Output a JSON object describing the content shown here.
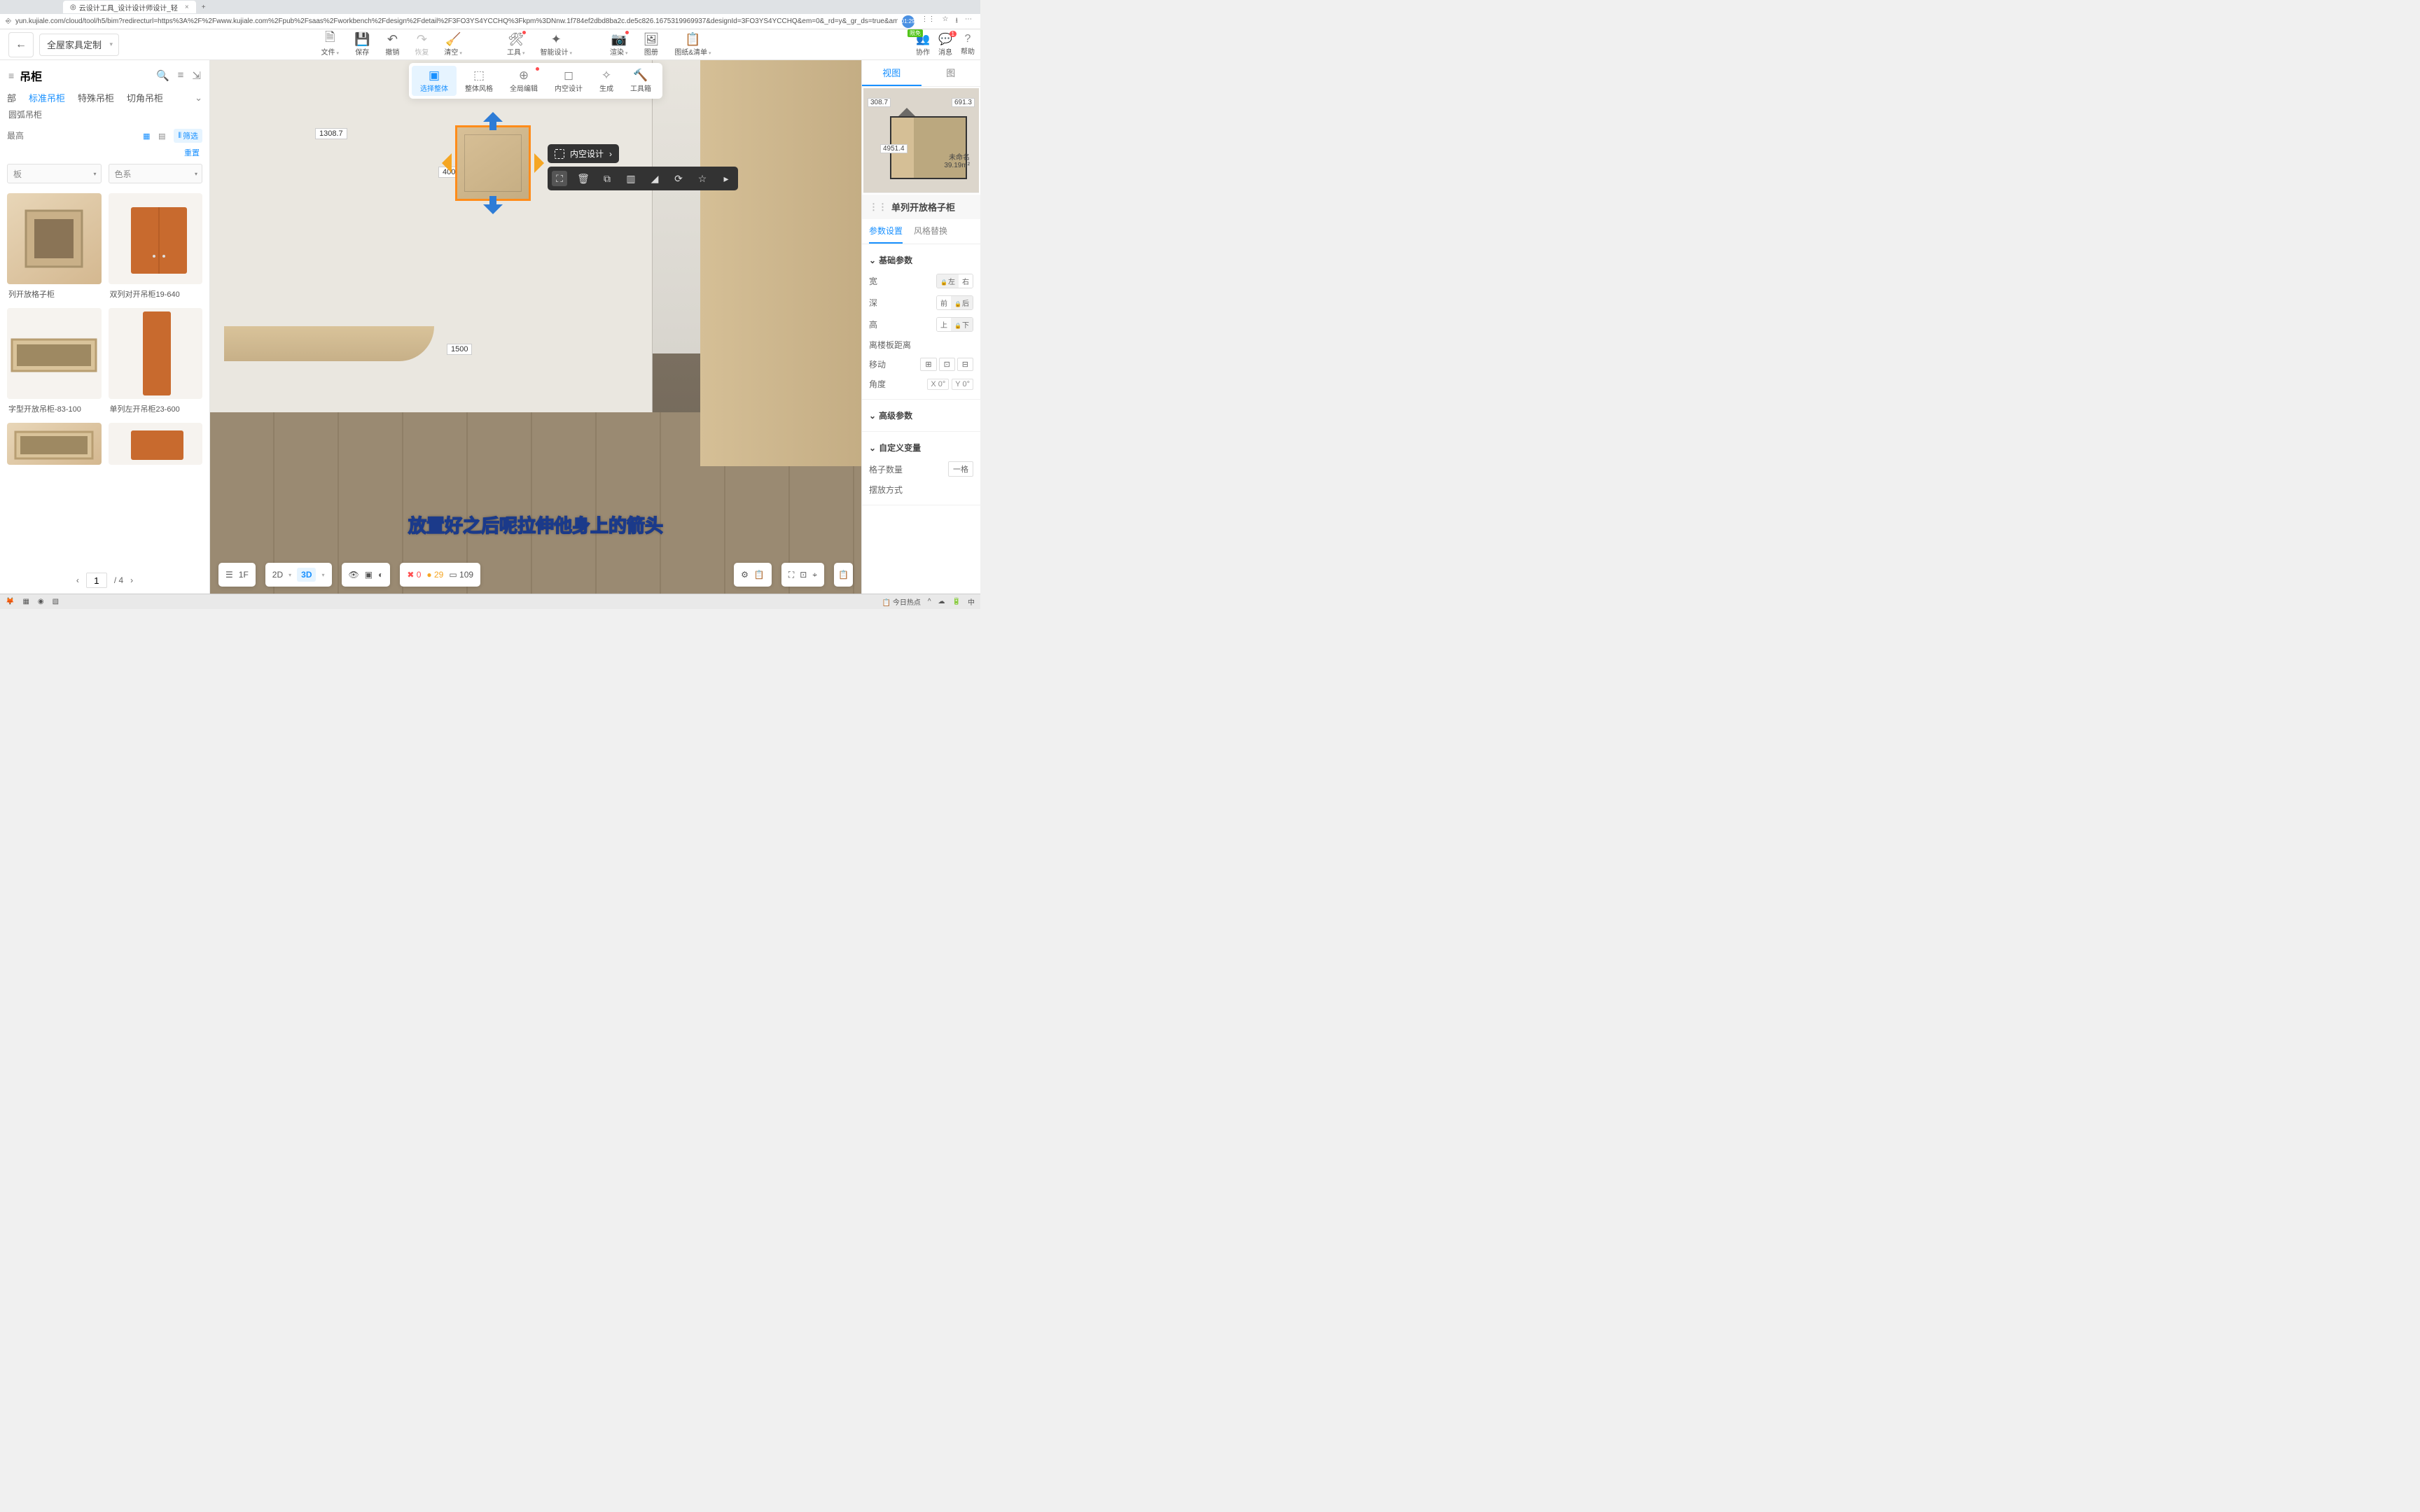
{
  "browser": {
    "tab_title": "云设计工具_设计设计师设计_轻",
    "url": "yun.kujiale.com/cloud/tool/h5/bim?redirecturl=https%3A%2F%2Fwww.kujiale.com%2Fpub%2Fsaas%2Fworkbench%2Fdesign%2Fdetail%2F3FO3YS4YCCHQ%3Fkpm%3DNnw.1f784ef2dbd8ba2c.de5c826.1675319969937&designId=3FO3YS4YCCHQ&em=0&_rd=y&_gr_ds=true&am=true",
    "avatar_time": "01:29"
  },
  "topbar": {
    "mode": "全屋家具定制",
    "tools": {
      "file": "文件",
      "save": "保存",
      "undo": "撤销",
      "redo": "恢复",
      "clear": "清空",
      "tools": "工具",
      "ai": "智能设计",
      "render": "渲染",
      "gallery": "图册",
      "drawings": "图纸&清单"
    },
    "right": {
      "collab": "协作",
      "msg": "消息",
      "help": "帮助",
      "limit": "限免",
      "badge": "1"
    }
  },
  "sub_toolbar": {
    "select_whole": "选择整体",
    "overall_style": "整体风格",
    "global_edit": "全局编辑",
    "interior_design": "内空设计",
    "generate": "生成",
    "toolbox": "工具箱"
  },
  "left": {
    "title": "吊柜",
    "tabs": {
      "all": "部",
      "standard": "标准吊柜",
      "special": "特殊吊柜",
      "corner": "切角吊柜"
    },
    "subrow": "圆弧吊柜",
    "placeholder": "最高",
    "filter_label": "筛选",
    "reset": "重置",
    "dd1": "板",
    "dd2": "色系",
    "items": [
      {
        "name": "列开放格子柜"
      },
      {
        "name": "双列对开吊柜19-640"
      },
      {
        "name": "字型开放吊柜-83-100"
      },
      {
        "name": "单列左开吊柜23-600"
      }
    ],
    "page_current": "1",
    "page_total": "/ 4"
  },
  "canvas": {
    "dim_top": "1308.7",
    "dim_side": "400",
    "dim_height": "1500",
    "context_label": "内空设计"
  },
  "subtitle": "放置好之后呢拉伸他身上的箭头",
  "bottombar": {
    "floor": "1F",
    "v2d": "2D",
    "v3d": "3D",
    "stat_err": "0",
    "stat_warn": "29",
    "stat_count": "109"
  },
  "right": {
    "tab_view": "视图",
    "tab_other": "图",
    "mm": {
      "d1": "308.7",
      "d2": "691.3",
      "d3": "4951.4",
      "room": "未命名",
      "area": "39.19m²"
    },
    "prop_title": "单列开放格子柜",
    "tabs2": {
      "params": "参数设置",
      "style": "风格替换"
    },
    "basic": "基础参数",
    "rows": {
      "width": "宽",
      "depth": "深",
      "height": "高",
      "floor_dist": "离楼板距离",
      "move": "移动",
      "angle": "角度"
    },
    "pills": {
      "w_left": "左",
      "w_right": "右",
      "d_front": "前",
      "d_back": "后",
      "h_up": "上",
      "h_down": "下"
    },
    "angle_x": "X 0°",
    "angle_y": "Y 0°",
    "adv": "高级参数",
    "custom": "自定义变量",
    "grid_count": "格子数量",
    "grid_val": "一格",
    "placement": "摆放方式"
  },
  "taskbar": {
    "news": "今日热点",
    "ime": "中"
  }
}
